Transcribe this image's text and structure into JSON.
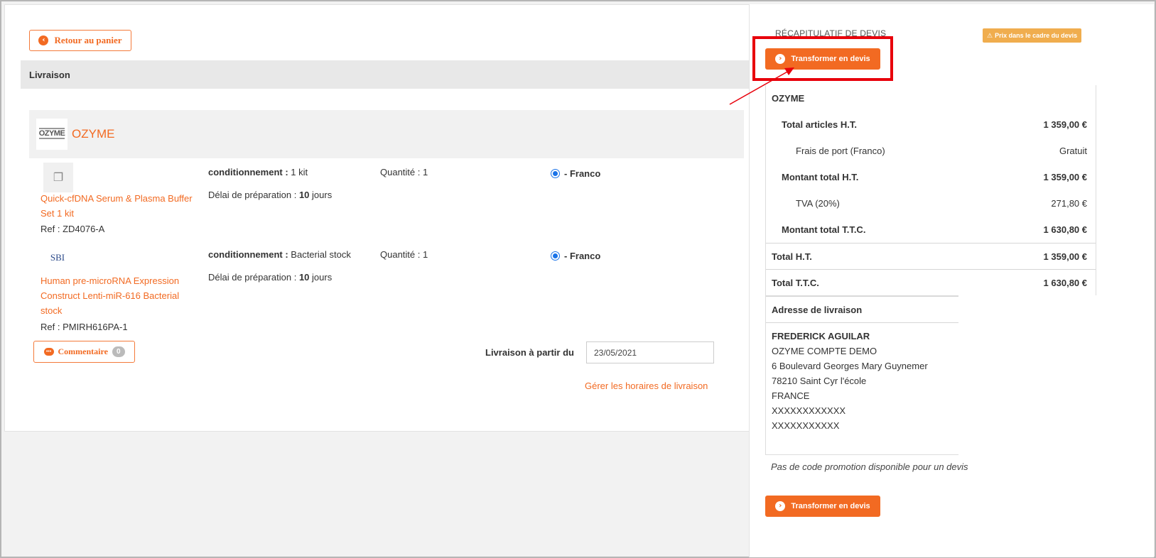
{
  "left": {
    "back_label": "Retour au panier",
    "section_title": "Livraison",
    "supplier": {
      "logo_text": "OZYME",
      "name": "OZYME"
    },
    "items": [
      {
        "product": "Quick-cfDNA Serum & Plasma Buffer Set 1 kit",
        "ref": "Ref : ZD4076-A",
        "cond_label": "conditionnement :",
        "cond_value": "1 kit",
        "qty": "Quantité : 1",
        "delai_label": "Délai de préparation :",
        "delai_value": "10",
        "delai_unit": "jours",
        "shipping": "- Franco"
      },
      {
        "logo_text": "SBI",
        "product": "Human pre-microRNA Expression Construct Lenti-miR-616 Bacterial stock",
        "ref": "Ref : PMIRH616PA-1",
        "cond_label": "conditionnement :",
        "cond_value": "Bacterial stock",
        "qty": "Quantité : 1",
        "delai_label": "Délai de préparation :",
        "delai_value": "10",
        "delai_unit": "jours",
        "shipping": "- Franco"
      }
    ],
    "comment_label": "Commentaire",
    "comment_count": "0",
    "delivery_from_label": "Livraison à partir du",
    "delivery_date": "23/05/2021",
    "hours_link": "Gérer les horaires de livraison"
  },
  "right": {
    "title": "RÉCAPITULATIF DE DEVIS",
    "price_warning": "Prix dans le cadre du devis",
    "transform_label": "Transformer en devis",
    "summary": {
      "supplier": "OZYME",
      "rows": [
        {
          "label": "Total articles H.T.",
          "value": "1 359,00 €"
        },
        {
          "label": "Frais de port (Franco)",
          "value": "Gratuit"
        },
        {
          "label": "Montant total H.T.",
          "value": "1 359,00 €"
        },
        {
          "label": "TVA (20%)",
          "value": "271,80 €"
        },
        {
          "label": "Montant total T.T.C.",
          "value": "1 630,80 €"
        }
      ],
      "total_ht_label": "Total H.T.",
      "total_ht_value": "1 359,00 €",
      "total_ttc_label": "Total T.T.C.",
      "total_ttc_value": "1 630,80 €"
    },
    "address": {
      "title": "Adresse de livraison",
      "lines": [
        "FREDERICK AGUILAR",
        "OZYME COMPTE DEMO",
        "6 Boulevard Georges Mary Guynemer",
        "78210 Saint Cyr l'école",
        "FRANCE",
        "XXXXXXXXXXXX",
        "XXXXXXXXXXX"
      ]
    },
    "promo_text": "Pas de code promotion disponible pour un devis"
  },
  "colors": {
    "accent": "#f26a22",
    "warning": "#f0ad4e",
    "highlight": "#e8000b"
  },
  "icons": [
    "arrow-left-circle-icon",
    "arrow-right-circle-icon",
    "image-placeholder-icon",
    "comment-icon",
    "warning-icon"
  ]
}
